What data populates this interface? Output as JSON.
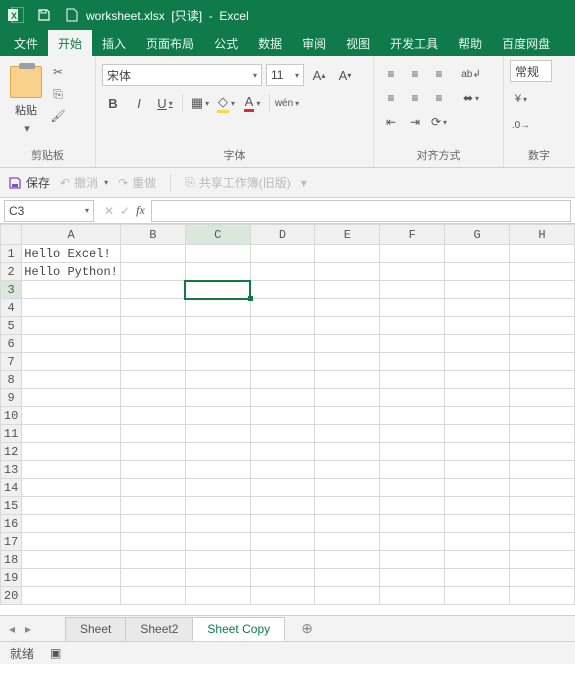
{
  "titlebar": {
    "filename": "worksheet.xlsx",
    "readonly": "[只读]",
    "appname": "Excel"
  },
  "tabs": {
    "file": "文件",
    "home": "开始",
    "insert": "插入",
    "layout": "页面布局",
    "formulas": "公式",
    "data": "数据",
    "review": "审阅",
    "view": "视图",
    "dev": "开发工具",
    "help": "帮助",
    "baidu": "百度网盘"
  },
  "ribbon": {
    "clipboard_label": "剪贴板",
    "paste": "粘贴",
    "font_label": "字体",
    "font_name": "宋体",
    "font_size": "11",
    "bold": "B",
    "italic": "I",
    "underline": "U",
    "wen": "wén",
    "align_label": "对齐方式",
    "number_label": "数字",
    "number_format": "常规"
  },
  "qat": {
    "save": "保存",
    "undo": "撤消",
    "redo": "重做",
    "share": "共享工作簿(旧版)"
  },
  "fx": {
    "namebox": "C3",
    "formula": ""
  },
  "grid": {
    "cols": [
      "A",
      "B",
      "C",
      "D",
      "E",
      "F",
      "G",
      "H"
    ],
    "rows": 20,
    "active_col": "C",
    "active_row": 3,
    "cells": {
      "A1": "Hello Excel!",
      "A2": "Hello Python!"
    }
  },
  "sheets": {
    "items": [
      "Sheet",
      "Sheet2",
      "Sheet Copy"
    ],
    "active_index": 2
  },
  "status": {
    "ready": "就绪"
  }
}
